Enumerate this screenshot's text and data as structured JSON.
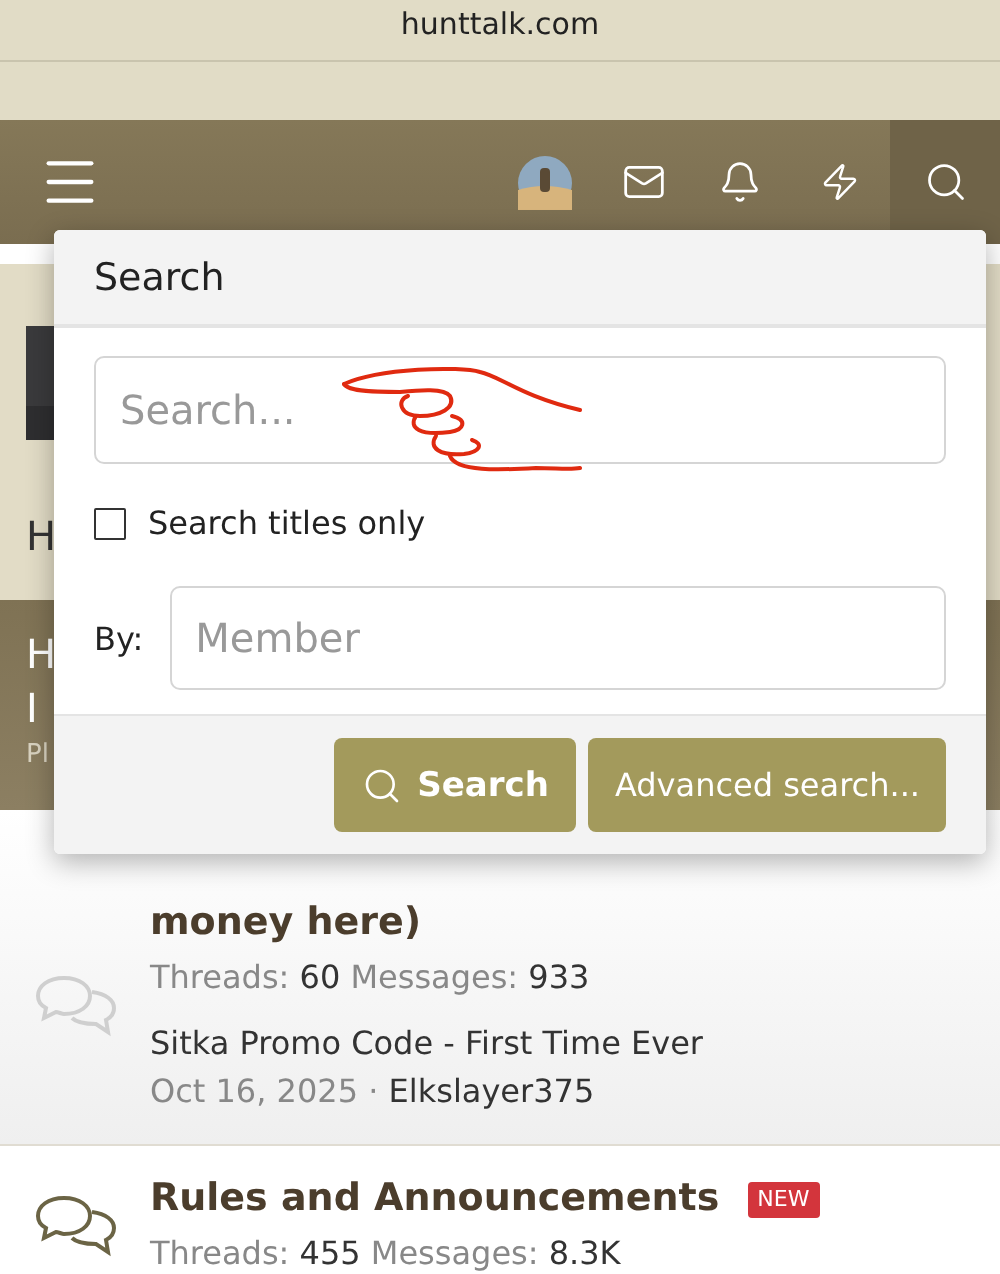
{
  "browser": {
    "address": "hunttalk.com"
  },
  "nav": {
    "icons": [
      {
        "kind": "menu"
      },
      {
        "kind": "avatar"
      },
      {
        "kind": "mail"
      },
      {
        "kind": "bell"
      },
      {
        "kind": "bolt"
      },
      {
        "kind": "search",
        "open": true
      }
    ]
  },
  "background": {
    "heading_fragment": "H",
    "banner_fragments": [
      "H",
      "I"
    ],
    "banner_sub_fragment": "Pl"
  },
  "search_popup": {
    "title": "Search",
    "query": {
      "placeholder": "Search..."
    },
    "titles_only": {
      "label": "Search titles only",
      "checked": false
    },
    "by_label": "By:",
    "member": {
      "placeholder": "Member"
    },
    "buttons": [
      {
        "kind": "primary",
        "label": "Search"
      },
      {
        "kind": "secondary",
        "label": "Advanced search..."
      }
    ]
  },
  "forums": [
    {
      "title": "money here)",
      "unread": false,
      "threads_label": "Threads:",
      "threads": "60",
      "messages_label": "Messages:",
      "messages": "933",
      "latest_title": "Sitka Promo Code - First Time Ever",
      "latest_date": "Oct 16, 2025",
      "latest_separator": "·",
      "latest_author": "Elkslayer375"
    },
    {
      "title": "Rules and Announcements",
      "unread": true,
      "badge": "NEW",
      "threads_label": "Threads:",
      "threads": "455",
      "messages_label": "Messages:",
      "messages": "8.3K"
    }
  ]
}
